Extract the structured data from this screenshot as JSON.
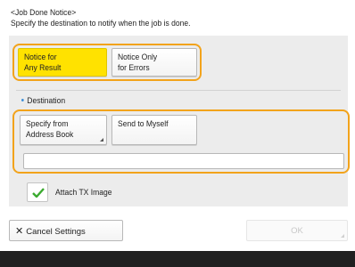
{
  "header": {
    "title": "<Job Done Notice>",
    "instruction": "Specify the destination to notify when the job is done."
  },
  "notice_options": {
    "any_result_label": "Notice for\nAny Result",
    "errors_only_label": "Notice Only\nfor Errors",
    "selected": "any_result"
  },
  "destination": {
    "label": "Destination",
    "address_book_label": "Specify from\nAddress Book",
    "send_to_myself_label": "Send to Myself",
    "address_value": ""
  },
  "attach": {
    "label": "Attach TX Image",
    "checked": true
  },
  "footer": {
    "cancel_label": "Cancel Settings",
    "ok_label": "OK"
  },
  "colors": {
    "selected": "#ffe200",
    "highlight_border": "#f2a31b",
    "check": "#3aaa2f",
    "bullet": "#3a8dd8"
  }
}
